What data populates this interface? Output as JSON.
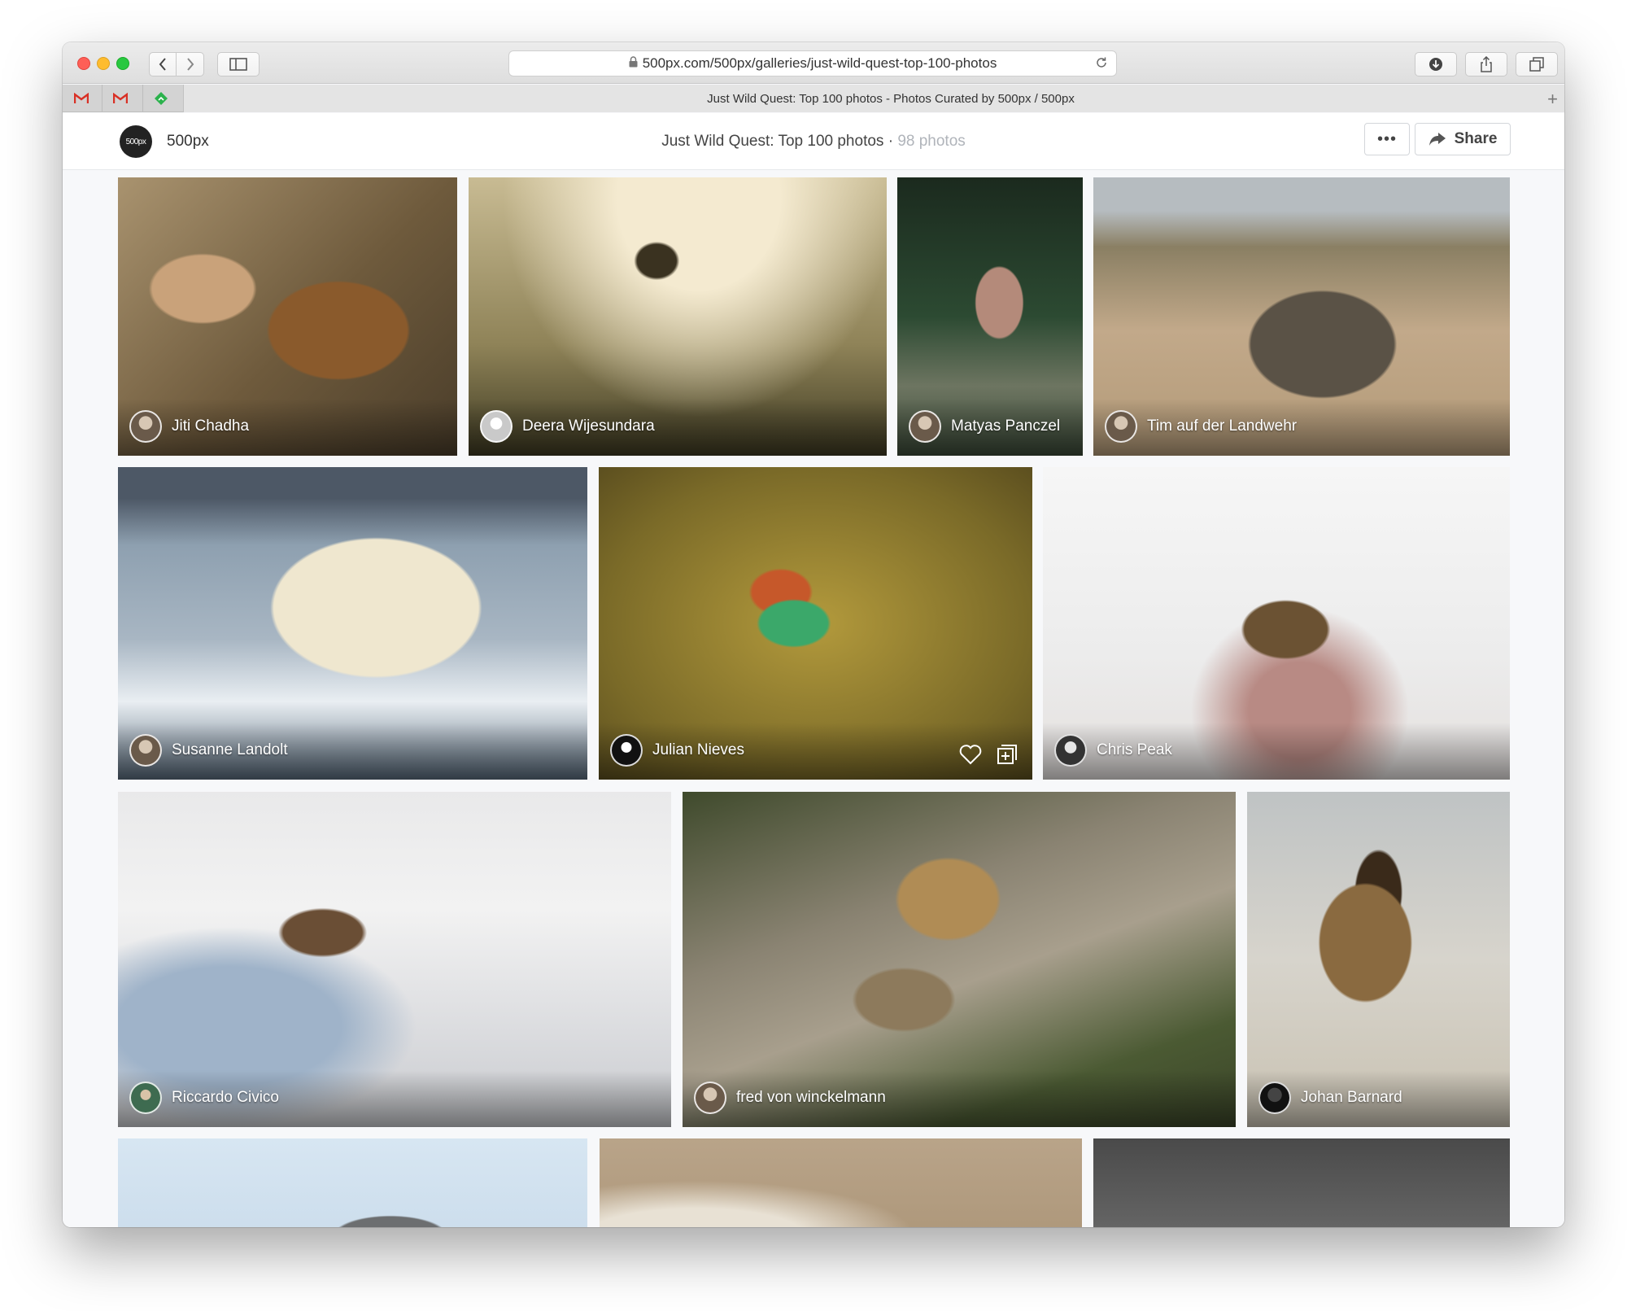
{
  "browser": {
    "url": "500px.com/500px/galleries/just-wild-quest-top-100-photos",
    "tab_title": "Just Wild Quest: Top 100 photos - Photos Curated by 500px / 500px"
  },
  "site": {
    "logo_text": "500px",
    "brand": "500px"
  },
  "gallery": {
    "title": "Just Wild Quest: Top 100 photos",
    "separator": " · ",
    "count": "98 photos",
    "share_label": "Share",
    "more_label": "•••"
  },
  "photos": [
    {
      "photographer": "Jiti Chadha"
    },
    {
      "photographer": "Deera Wijesundara"
    },
    {
      "photographer": "Matyas Panczel"
    },
    {
      "photographer": "Tim auf der Landwehr"
    },
    {
      "photographer": "Susanne Landolt"
    },
    {
      "photographer": "Julian Nieves"
    },
    {
      "photographer": "Chris Peak"
    },
    {
      "photographer": "Riccardo Civico"
    },
    {
      "photographer": "fred von winckelmann"
    },
    {
      "photographer": "Johan Barnard"
    },
    {
      "photographer": ""
    },
    {
      "photographer": ""
    },
    {
      "photographer": ""
    }
  ],
  "colors": {
    "close": "#fe5f57",
    "minimize": "#febc2e",
    "maximize": "#28c840",
    "gmail_red": "#d93025",
    "feedly_green": "#2bb24c"
  }
}
